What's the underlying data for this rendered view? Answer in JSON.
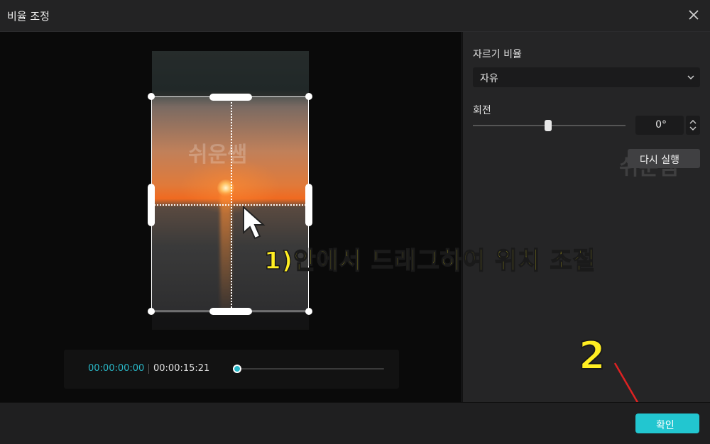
{
  "window": {
    "title": "비율 조정"
  },
  "preview": {
    "watermark": "쉬운쌤",
    "annotation_step1": "1)안에서 드래그하여 위치 조절",
    "annotation_step2": "2"
  },
  "timeline": {
    "current": "00:00:00:00",
    "duration": "00:00:15:21",
    "playhead_fraction": 0.0
  },
  "panel": {
    "crop_ratio_label": "자르기 비율",
    "crop_ratio_value": "자유",
    "rotation_label": "회전",
    "rotation_value": "0°",
    "reset_label": "다시 실행",
    "watermark": "쉬운쌤"
  },
  "footer": {
    "confirm_label": "확인"
  },
  "colors": {
    "accent": "#22c6d0",
    "annotation": "#ffee22",
    "arrow": "#dd2222"
  },
  "icons": [
    "close-icon",
    "chevron-down-icon",
    "stepper-icon",
    "mouse-pointer-icon",
    "red-arrow-icon"
  ]
}
